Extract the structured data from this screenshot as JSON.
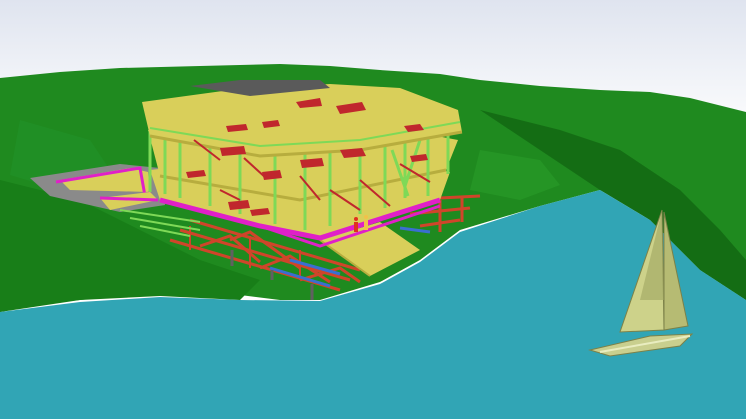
{
  "scene": {
    "kind": "3d-bim-model-viewport",
    "elements": [
      "sky",
      "terrain",
      "water",
      "building-structure",
      "steel-frame-platform",
      "sailboat",
      "human-figures"
    ],
    "colors": {
      "sky_top": "#dfe4ef",
      "sky_bottom": "#ffffff",
      "terrain": "#1f8a1f",
      "terrain_dark": "#146d14",
      "water": "#31a5b5",
      "slab": "#d9cf5a",
      "slab_edge": "#b7ad3e",
      "columns": "#7ed957",
      "openings": "#c0272d",
      "beam_magenta": "#e020c8",
      "steel_frame": "#d0452a",
      "steel_blue": "#3a6fd0",
      "roof_grey": "#5a5a5a",
      "sail": "#cdd28a",
      "hull": "#c9cf8e"
    }
  }
}
